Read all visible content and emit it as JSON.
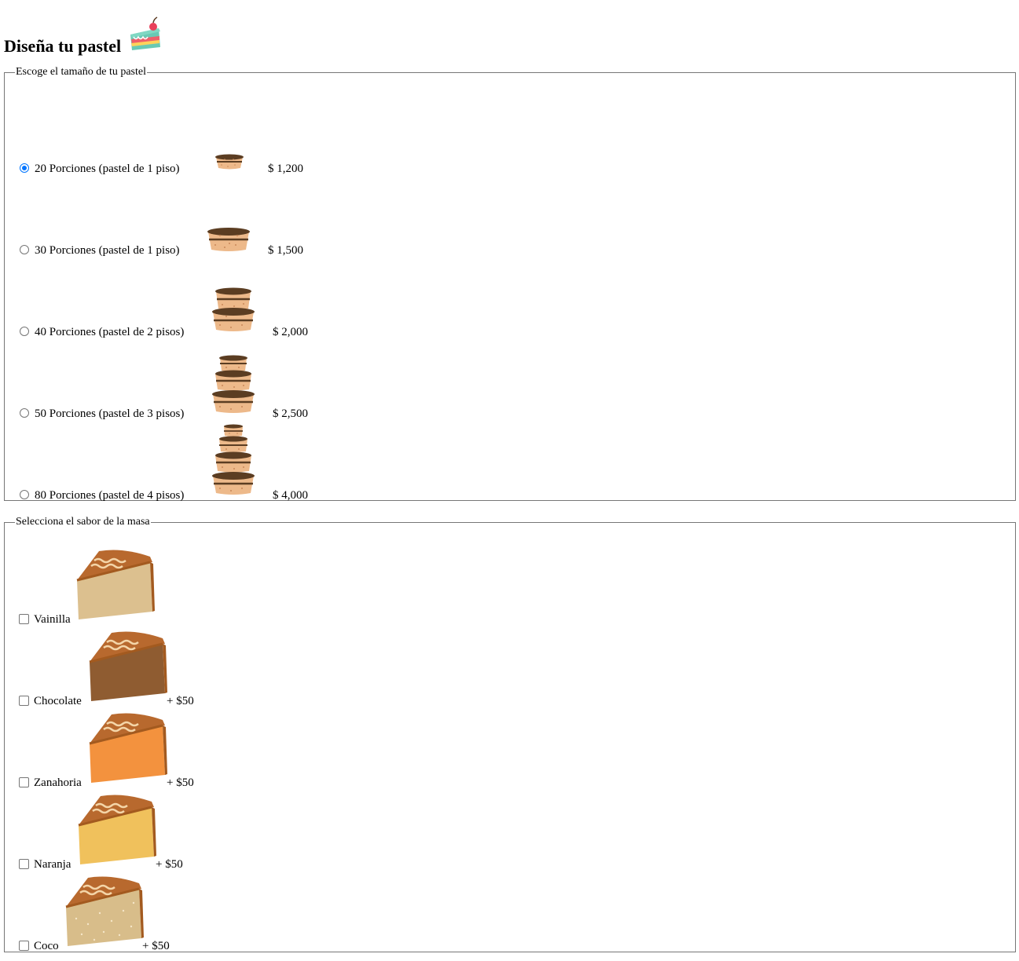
{
  "page": {
    "title": "Diseña tu pastel",
    "title_icon": "cake-slice-icon"
  },
  "size_section": {
    "legend": "Escoge el tamaño de tu pastel",
    "options": [
      {
        "label": "20 Porciones (pastel de 1 piso)",
        "price": "$ 1,200",
        "selected": true,
        "icon": "cake-1-tier-small-icon"
      },
      {
        "label": "30 Porciones (pastel de 1 piso)",
        "price": "$ 1,500",
        "selected": false,
        "icon": "cake-1-tier-icon"
      },
      {
        "label": "40 Porciones (pastel de 2 pisos)",
        "price": "$ 2,000",
        "selected": false,
        "icon": "cake-2-tier-icon"
      },
      {
        "label": "50 Porciones (pastel de 3 pisos)",
        "price": "$ 2,500",
        "selected": false,
        "icon": "cake-3-tier-icon"
      },
      {
        "label": "80 Porciones (pastel de 4 pisos)",
        "price": "$ 4,000",
        "selected": false,
        "icon": "cake-4-tier-icon"
      }
    ]
  },
  "flavor_section": {
    "legend": "Selecciona el sabor de la masa",
    "options": [
      {
        "label": "Vainilla",
        "price": "",
        "checked": false,
        "color": "#dcc08f",
        "icon": "vanilla-slice-icon"
      },
      {
        "label": "Chocolate",
        "price": "+ $50",
        "checked": false,
        "color": "#8f5c31",
        "icon": "chocolate-slice-icon"
      },
      {
        "label": "Zanahoria",
        "price": "+ $50",
        "checked": false,
        "color": "#f3923e",
        "icon": "carrot-slice-icon"
      },
      {
        "label": "Naranja",
        "price": "+ $50",
        "checked": false,
        "color": "#f0c15c",
        "icon": "orange-slice-icon"
      },
      {
        "label": "Coco",
        "price": "+ $50",
        "checked": false,
        "color": "#d8bd8a",
        "icon": "coconut-slice-icon"
      }
    ]
  },
  "colors": {
    "cake_body": "#edb98a",
    "cake_frosting": "#5b3d22",
    "slice_top": "#b8692e",
    "slice_cream": "#f4d5a8",
    "radio_accent": "#0075ff"
  }
}
